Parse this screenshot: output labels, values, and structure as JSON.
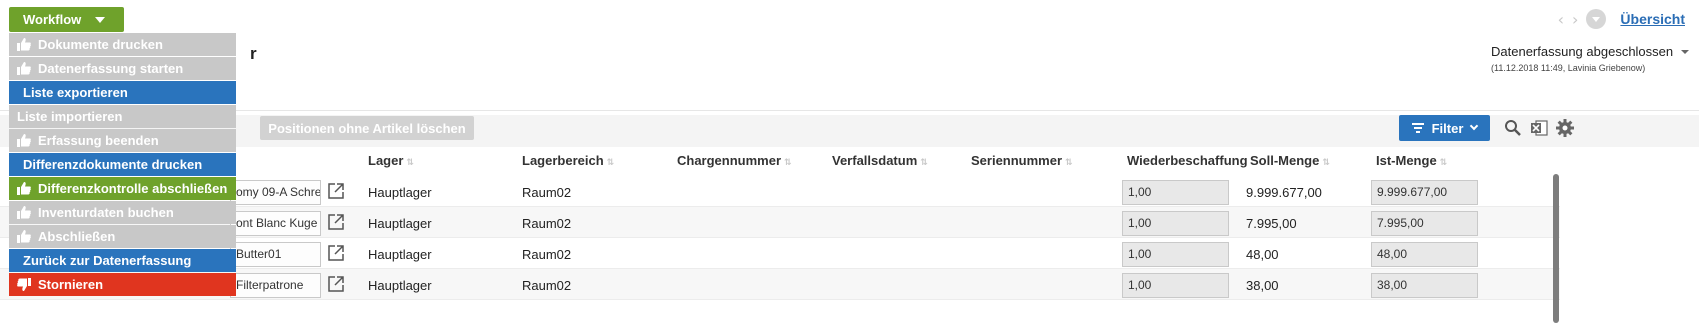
{
  "header": {
    "workflow_label": "Workflow",
    "title_fragment": "r",
    "overview_link": "Übersicht",
    "status": "Datenerfassung abgeschlossen",
    "status_sub": "(11.12.2018 11:49, Lavinia Griebenow)"
  },
  "workflow_menu": [
    {
      "label": "Dokumente drucken",
      "style": "grey",
      "icon": "thumbs-up-icon"
    },
    {
      "label": "Datenerfassung starten",
      "style": "grey",
      "icon": "thumbs-up-icon"
    },
    {
      "label": "Liste exportieren",
      "style": "blue",
      "icon": ""
    },
    {
      "label": "Liste importieren",
      "style": "grey",
      "icon": ""
    },
    {
      "label": "Erfassung beenden",
      "style": "grey",
      "icon": "thumbs-up-icon"
    },
    {
      "label": "Differenzdokumente drucken",
      "style": "blue",
      "icon": ""
    },
    {
      "label": "Differenzkontrolle abschließen",
      "style": "green",
      "icon": "thumbs-up-icon"
    },
    {
      "label": "Inventurdaten buchen",
      "style": "grey",
      "icon": "thumbs-up-icon"
    },
    {
      "label": "Abschließen",
      "style": "grey",
      "icon": "thumbs-up-icon"
    },
    {
      "label": "Zurück zur Datenerfassung",
      "style": "blue",
      "icon": ""
    },
    {
      "label": "Stornieren",
      "style": "red",
      "icon": "thumbs-down-icon"
    }
  ],
  "toolbar": {
    "delete_positions_label": "Positionen ohne Artikel löschen",
    "filter_label": "Filter"
  },
  "table": {
    "columns": {
      "lager": "Lager",
      "lagerbereich": "Lagerbereich",
      "chargennummer": "Chargennummer",
      "verfallsdatum": "Verfallsdatum",
      "seriennummer": "Seriennummer",
      "wiederbeschaffung": "Wiederbeschaffungs",
      "soll_menge": "Soll-Menge",
      "ist_menge": "Ist-Menge"
    },
    "rows": [
      {
        "artikel": "omy 09-A Schre",
        "lager": "Hauptlager",
        "lagerbereich": "Raum02",
        "wiederbeschaffung": "1,00",
        "soll": "9.999.677,00",
        "ist": "9.999.677,00"
      },
      {
        "artikel": "ont Blanc Kuge",
        "lager": "Hauptlager",
        "lagerbereich": "Raum02",
        "wiederbeschaffung": "1,00",
        "soll": "7.995,00",
        "ist": "7.995,00"
      },
      {
        "artikel": "Butter01",
        "lager": "Hauptlager",
        "lagerbereich": "Raum02",
        "wiederbeschaffung": "1,00",
        "soll": "48,00",
        "ist": "48,00"
      },
      {
        "artikel": "Filterpatrone",
        "lager": "Hauptlager",
        "lagerbereich": "Raum02",
        "wiederbeschaffung": "1,00",
        "soll": "38,00",
        "ist": "38,00"
      }
    ]
  },
  "colors": {
    "workflow_green": "#6fa22b",
    "action_blue": "#2a74bd",
    "cancel_red": "#e0351f",
    "disabled_grey": "#c8c8c8",
    "link_blue": "#2a6db5"
  }
}
